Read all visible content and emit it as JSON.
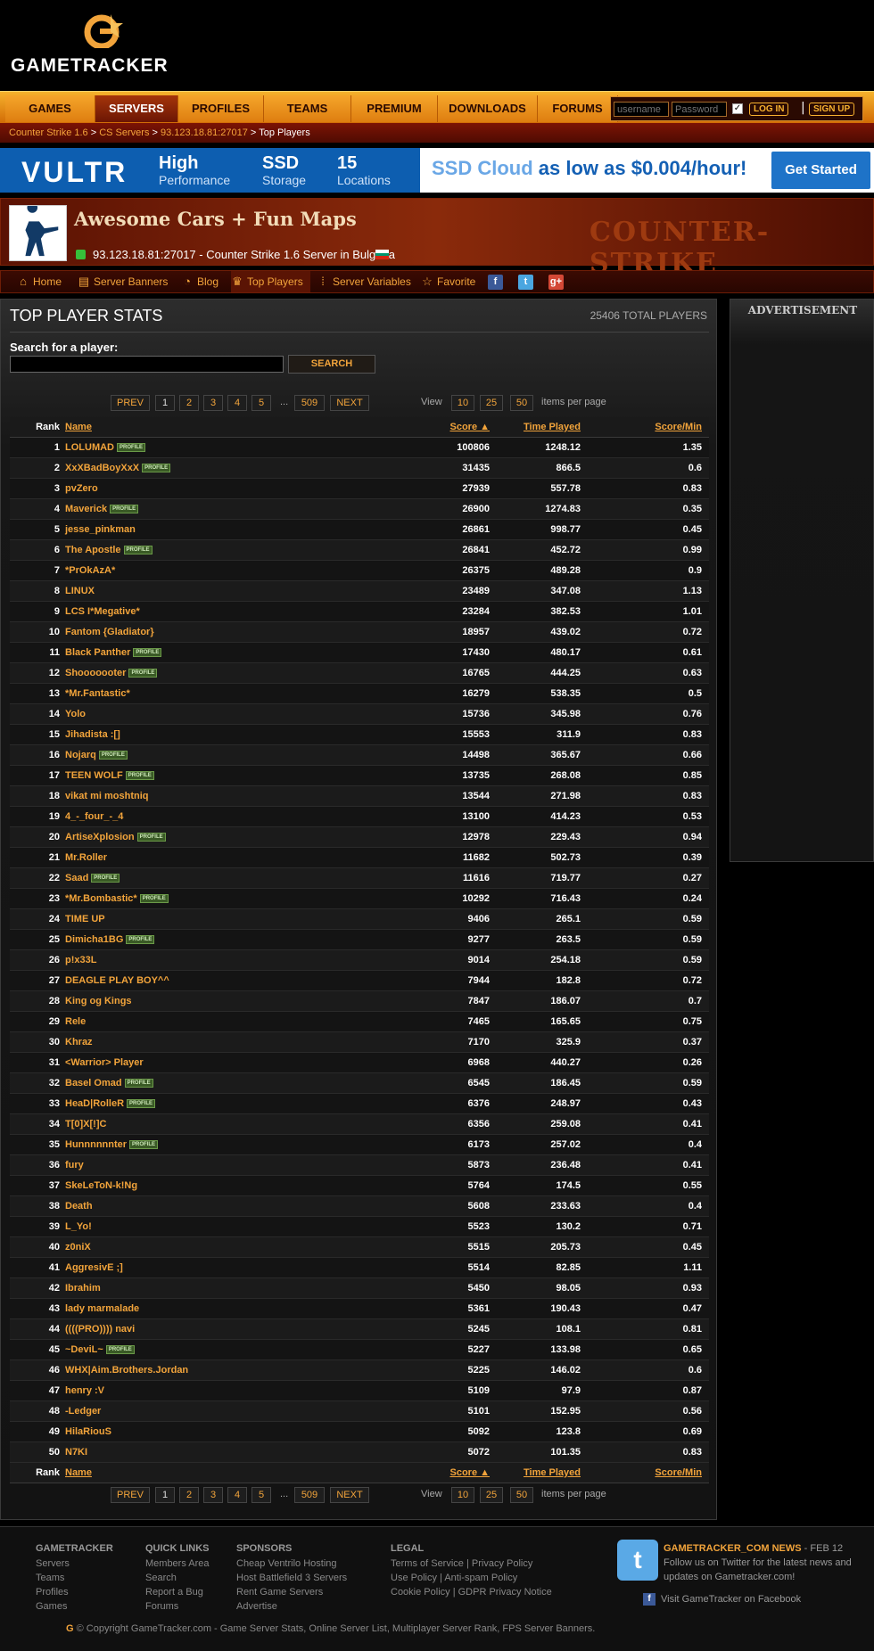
{
  "header": {
    "logo_text": "GAMETRACKER"
  },
  "nav": {
    "tabs": [
      {
        "label": "GAMES",
        "active": false
      },
      {
        "label": "SERVERS",
        "active": true
      },
      {
        "label": "PROFILES",
        "active": false
      },
      {
        "label": "TEAMS",
        "active": false
      },
      {
        "label": "PREMIUM",
        "active": false
      },
      {
        "label": "DOWNLOADS",
        "active": false
      },
      {
        "label": "FORUMS",
        "active": false
      }
    ],
    "login": {
      "username_placeholder": "username",
      "password_placeholder": "Password",
      "login_label": "LOG IN",
      "signup_label": "SIGN UP"
    }
  },
  "breadcrumb": {
    "items": [
      "Counter Strike 1.6",
      "CS Servers",
      "93.123.18.81:27017"
    ],
    "current": "Top Players"
  },
  "banner": {
    "brand": "VULTR",
    "features": [
      {
        "big": "High",
        "small": "Performance"
      },
      {
        "big": "SSD",
        "small": "Storage"
      },
      {
        "big": "15",
        "small": "Locations"
      }
    ],
    "tagline_a": "SSD Cloud",
    "tagline_b": " as low as $0.004/hour!",
    "cta": "Get Started"
  },
  "server": {
    "name": "Awesome Cars + Fun Maps",
    "address_line": "93.123.18.81:27017 - Counter Strike 1.6 Server in Bulgaria",
    "game_logo": "COUNTER-STRIKE"
  },
  "subnav": {
    "items": [
      {
        "label": "Home",
        "icon": "home-icon"
      },
      {
        "label": "Server Banners",
        "icon": "banner-icon"
      },
      {
        "label": "Blog",
        "icon": "rss-icon"
      },
      {
        "label": "Top Players",
        "icon": "trophy-icon",
        "active": true
      },
      {
        "label": "Server Variables",
        "icon": "grid-icon"
      },
      {
        "label": "Favorite",
        "icon": "star-icon"
      }
    ],
    "social": [
      "f",
      "t",
      "g+"
    ]
  },
  "stats": {
    "title": "TOP PLAYER STATS",
    "total": "25406 TOTAL PLAYERS",
    "search_label": "Search for a player:",
    "search_button": "SEARCH",
    "pager": {
      "prev": "PREV",
      "pages": [
        "1",
        "2",
        "3",
        "4",
        "5"
      ],
      "ellipsis": "...",
      "last": "509",
      "next": "NEXT",
      "view_label": "View",
      "sizes": [
        "10",
        "25",
        "50"
      ],
      "items_label": "items per page"
    },
    "columns": {
      "rank": "Rank",
      "name": "Name",
      "score": "Score ▲",
      "time": "Time Played",
      "spm": "Score/Min"
    },
    "profile_badge": "PROFILE",
    "players": [
      {
        "rank": "1",
        "name": "LOLUMAD",
        "profile": true,
        "score": "100806",
        "time": "1248.12",
        "spm": "1.35"
      },
      {
        "rank": "2",
        "name": "XxXBadBoyXxX",
        "profile": true,
        "score": "31435",
        "time": "866.5",
        "spm": "0.6"
      },
      {
        "rank": "3",
        "name": "pvZero",
        "profile": false,
        "score": "27939",
        "time": "557.78",
        "spm": "0.83"
      },
      {
        "rank": "4",
        "name": "Maverick",
        "profile": true,
        "score": "26900",
        "time": "1274.83",
        "spm": "0.35"
      },
      {
        "rank": "5",
        "name": "jesse_pinkman",
        "profile": false,
        "score": "26861",
        "time": "998.77",
        "spm": "0.45"
      },
      {
        "rank": "6",
        "name": "The Apostle",
        "profile": true,
        "score": "26841",
        "time": "452.72",
        "spm": "0.99"
      },
      {
        "rank": "7",
        "name": "*PrOkAzA*",
        "profile": false,
        "score": "26375",
        "time": "489.28",
        "spm": "0.9"
      },
      {
        "rank": "8",
        "name": "LINUX",
        "profile": false,
        "score": "23489",
        "time": "347.08",
        "spm": "1.13"
      },
      {
        "rank": "9",
        "name": "LCS I*Megative*",
        "profile": false,
        "score": "23284",
        "time": "382.53",
        "spm": "1.01"
      },
      {
        "rank": "10",
        "name": "Fantom {Gladiator}",
        "profile": false,
        "score": "18957",
        "time": "439.02",
        "spm": "0.72"
      },
      {
        "rank": "11",
        "name": "Black Panther",
        "profile": true,
        "score": "17430",
        "time": "480.17",
        "spm": "0.61"
      },
      {
        "rank": "12",
        "name": "Shooooooter",
        "profile": true,
        "score": "16765",
        "time": "444.25",
        "spm": "0.63"
      },
      {
        "rank": "13",
        "name": "*Mr.Fantastic*",
        "profile": false,
        "score": "16279",
        "time": "538.35",
        "spm": "0.5"
      },
      {
        "rank": "14",
        "name": "Yolo",
        "profile": false,
        "score": "15736",
        "time": "345.98",
        "spm": "0.76"
      },
      {
        "rank": "15",
        "name": "Jihadista :[]",
        "profile": false,
        "score": "15553",
        "time": "311.9",
        "spm": "0.83"
      },
      {
        "rank": "16",
        "name": "Nojarq",
        "profile": true,
        "score": "14498",
        "time": "365.67",
        "spm": "0.66"
      },
      {
        "rank": "17",
        "name": "TEEN WOLF",
        "profile": true,
        "score": "13735",
        "time": "268.08",
        "spm": "0.85"
      },
      {
        "rank": "18",
        "name": "vikat mi moshtniq",
        "profile": false,
        "score": "13544",
        "time": "271.98",
        "spm": "0.83"
      },
      {
        "rank": "19",
        "name": "4_-_four_-_4",
        "profile": false,
        "score": "13100",
        "time": "414.23",
        "spm": "0.53"
      },
      {
        "rank": "20",
        "name": "ArtiseXplosion",
        "profile": true,
        "score": "12978",
        "time": "229.43",
        "spm": "0.94"
      },
      {
        "rank": "21",
        "name": "Mr.Roller",
        "profile": false,
        "score": "11682",
        "time": "502.73",
        "spm": "0.39"
      },
      {
        "rank": "22",
        "name": "Saad",
        "profile": true,
        "score": "11616",
        "time": "719.77",
        "spm": "0.27"
      },
      {
        "rank": "23",
        "name": "*Mr.Bombastic*",
        "profile": true,
        "score": "10292",
        "time": "716.43",
        "spm": "0.24"
      },
      {
        "rank": "24",
        "name": "TIME UP",
        "profile": false,
        "score": "9406",
        "time": "265.1",
        "spm": "0.59"
      },
      {
        "rank": "25",
        "name": "Dimicha1BG",
        "profile": true,
        "score": "9277",
        "time": "263.5",
        "spm": "0.59"
      },
      {
        "rank": "26",
        "name": "p!x33L",
        "profile": false,
        "score": "9014",
        "time": "254.18",
        "spm": "0.59"
      },
      {
        "rank": "27",
        "name": "DEAGLE PLAY BOY^^",
        "profile": false,
        "score": "7944",
        "time": "182.8",
        "spm": "0.72"
      },
      {
        "rank": "28",
        "name": "King og Kings",
        "profile": false,
        "score": "7847",
        "time": "186.07",
        "spm": "0.7"
      },
      {
        "rank": "29",
        "name": "Rele",
        "profile": false,
        "score": "7465",
        "time": "165.65",
        "spm": "0.75"
      },
      {
        "rank": "30",
        "name": "Khraz",
        "profile": false,
        "score": "7170",
        "time": "325.9",
        "spm": "0.37"
      },
      {
        "rank": "31",
        "name": "<Warrior> Player",
        "profile": false,
        "score": "6968",
        "time": "440.27",
        "spm": "0.26"
      },
      {
        "rank": "32",
        "name": "Basel Omad",
        "profile": true,
        "score": "6545",
        "time": "186.45",
        "spm": "0.59"
      },
      {
        "rank": "33",
        "name": "HeaD|RolleR",
        "profile": true,
        "score": "6376",
        "time": "248.97",
        "spm": "0.43"
      },
      {
        "rank": "34",
        "name": "T[0]X[!]C",
        "profile": false,
        "score": "6356",
        "time": "259.08",
        "spm": "0.41"
      },
      {
        "rank": "35",
        "name": "Hunnnnnnter",
        "profile": true,
        "score": "6173",
        "time": "257.02",
        "spm": "0.4"
      },
      {
        "rank": "36",
        "name": "fury",
        "profile": false,
        "score": "5873",
        "time": "236.48",
        "spm": "0.41"
      },
      {
        "rank": "37",
        "name": "SkeLeToN-k!Ng",
        "profile": false,
        "score": "5764",
        "time": "174.5",
        "spm": "0.55"
      },
      {
        "rank": "38",
        "name": "Death",
        "profile": false,
        "score": "5608",
        "time": "233.63",
        "spm": "0.4"
      },
      {
        "rank": "39",
        "name": "L_Yo!",
        "profile": false,
        "score": "5523",
        "time": "130.2",
        "spm": "0.71"
      },
      {
        "rank": "40",
        "name": "z0niX",
        "profile": false,
        "score": "5515",
        "time": "205.73",
        "spm": "0.45"
      },
      {
        "rank": "41",
        "name": "AggresivE ;]",
        "profile": false,
        "score": "5514",
        "time": "82.85",
        "spm": "1.11"
      },
      {
        "rank": "42",
        "name": "Ibrahim",
        "profile": false,
        "score": "5450",
        "time": "98.05",
        "spm": "0.93"
      },
      {
        "rank": "43",
        "name": "lady marmalade",
        "profile": false,
        "score": "5361",
        "time": "190.43",
        "spm": "0.47"
      },
      {
        "rank": "44",
        "name": "((((PRO)))) navi",
        "profile": false,
        "score": "5245",
        "time": "108.1",
        "spm": "0.81"
      },
      {
        "rank": "45",
        "name": "~DeviL~",
        "profile": true,
        "score": "5227",
        "time": "133.98",
        "spm": "0.65"
      },
      {
        "rank": "46",
        "name": "WHX|Aim.Brothers.Jordan",
        "profile": false,
        "score": "5225",
        "time": "146.02",
        "spm": "0.6"
      },
      {
        "rank": "47",
        "name": "henry :V",
        "profile": false,
        "score": "5109",
        "time": "97.9",
        "spm": "0.87"
      },
      {
        "rank": "48",
        "name": "-Ledger",
        "profile": false,
        "score": "5101",
        "time": "152.95",
        "spm": "0.56"
      },
      {
        "rank": "49",
        "name": "HilaRiouS",
        "profile": false,
        "score": "5092",
        "time": "123.8",
        "spm": "0.69"
      },
      {
        "rank": "50",
        "name": "N7KI",
        "profile": false,
        "score": "5072",
        "time": "101.35",
        "spm": "0.83"
      }
    ]
  },
  "sidebar": {
    "ad_label": "ADVERTISEMENT"
  },
  "footer": {
    "columns": [
      {
        "title": "GAMETRACKER",
        "links": [
          "Servers",
          "Teams",
          "Profiles",
          "Games"
        ]
      },
      {
        "title": "QUICK LINKS",
        "links": [
          "Members Area",
          "Search",
          "Report a Bug",
          "Forums"
        ]
      },
      {
        "title": "SPONSORS",
        "links": [
          "Cheap Ventrilo Hosting",
          "Host Battlefield 3 Servers",
          "Rent Game Servers",
          "Advertise"
        ]
      },
      {
        "title": "LEGAL",
        "links": [
          "Terms of Service | Privacy Policy",
          "Use Policy | Anti-spam Policy",
          "Cookie Policy | GDPR Privacy Notice"
        ]
      }
    ],
    "news_title": "GAMETRACKER_COM NEWS",
    "news_date": " - FEB 12",
    "news_text": "Follow us on Twitter for the latest news and updates on Gametracker.com!",
    "facebook": "Visit GameTracker on Facebook",
    "copyright": "© Copyright GameTracker.com - Game Server Stats, Online Server List, Multiplayer Server Rank, FPS Server Banners."
  },
  "colors": {
    "accent": "#f2a43b",
    "nav_active": "#8a1f05",
    "banner_blue": "#0d5eb0"
  }
}
